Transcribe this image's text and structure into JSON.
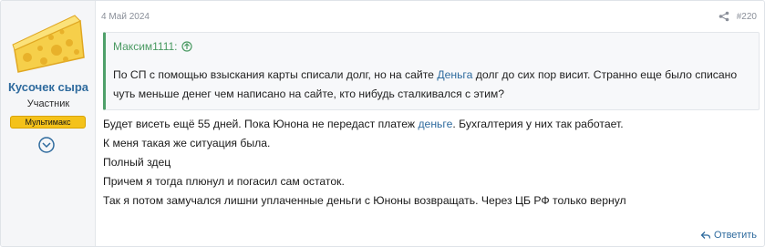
{
  "post": {
    "date": "4 Май 2024",
    "number": "#220",
    "reply_label": "Ответить"
  },
  "user": {
    "name": "Кусочек сыра",
    "title": "Участник",
    "banner": "Мультимакс"
  },
  "quote": {
    "author": "Максим1111:",
    "body_before": "По СП с помощью взыскания карты списали долг, но на сайте ",
    "link_text": "Деньга",
    "body_after": " долг до сих пор висит. Странно еще было списано чуть меньше денег чем написано на сайте, кто нибудь сталкивался с этим?"
  },
  "message": {
    "line1_before": "Будет висеть ещё 55 дней. Пока Юнона не передаст платеж ",
    "line1_link": "деньге",
    "line1_after": ". Бухгалтерия у них так работает.",
    "line2": "К меня такая же ситуация была.",
    "line3": "Полный здец",
    "line4": "Причем я тогда плюнул и погасил сам остаток.",
    "line5": "Так я потом замучался лишни уплаченные деньги с Юноны возвращать. Через ЦБ РФ только вернул"
  },
  "colors": {
    "link": "#2f6b9e",
    "quote_accent": "#4fa06a",
    "banner": "#f4c21a"
  }
}
